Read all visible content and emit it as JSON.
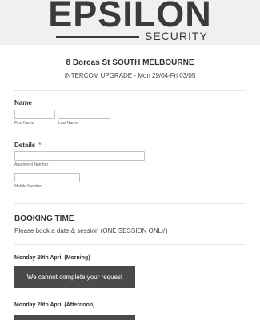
{
  "logo": {
    "word": "EPSILON",
    "tagline": "SECURITY"
  },
  "form": {
    "title": "8 Dorcas St SOUTH MELBOURNE",
    "subtitle": "INTERCOM UPGRADE - Mon 29/04-Fri 03/05",
    "name": {
      "label": "Name",
      "first_sublabel": "First Name",
      "last_sublabel": "Last Name",
      "first_value": "",
      "last_value": ""
    },
    "details": {
      "label": "Details",
      "required_mark": "*",
      "apartment_sublabel": "Apartment Number",
      "mobile_sublabel": "Mobile Number",
      "apartment_value": "",
      "mobile_value": ""
    },
    "booking": {
      "title": "BOOKING TIME",
      "description": "Please book a date & session (ONE SESSION ONLY)",
      "slots": [
        {
          "label": "Monday 29th April (Morning)",
          "message": "We cannot complete your request"
        },
        {
          "label": "Monday 29th April (Afternoon)",
          "message": ""
        }
      ]
    }
  },
  "colors": {
    "header_bg": "#f0f0f0",
    "logo": "#3a3a3a",
    "error_bg": "#4a4a4a",
    "input_border": "#b7c3d6",
    "required": "#c0392b"
  }
}
